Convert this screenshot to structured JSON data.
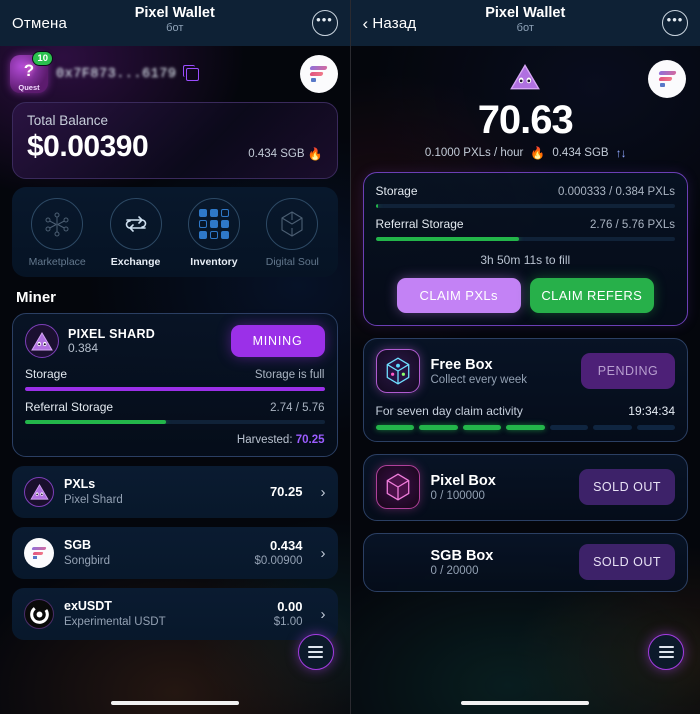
{
  "left": {
    "header": {
      "back_label": "Отмена",
      "title": "Pixel Wallet",
      "subtitle": "бот",
      "more_icon": "•••"
    },
    "quest": {
      "label": "Quest",
      "badge": "10",
      "glyph": "?"
    },
    "account": {
      "address": "0x7F873...6179",
      "copy_icon": "copy-icon"
    },
    "balance": {
      "label": "Total Balance",
      "amount": "$0.00390",
      "secondary": "0.434 SGB",
      "flame_icon": "flame-icon"
    },
    "actions": [
      {
        "name": "Marketplace",
        "icon": "nft-network-icon",
        "active": false
      },
      {
        "name": "Exchange",
        "icon": "swap-arrows-icon",
        "active": true
      },
      {
        "name": "Inventory",
        "icon": "grid-icon",
        "active": true
      },
      {
        "name": "Digital Soul",
        "icon": "cube-icon",
        "active": false
      }
    ],
    "section_title": "Miner",
    "miner": {
      "name": "PIXEL SHARD",
      "amount": "0.384",
      "button": "MINING",
      "storage_label": "Storage",
      "storage_value": "Storage is full",
      "storage_pct": 100,
      "referral_label": "Referral Storage",
      "referral_value": "2.74 / 5.76",
      "referral_pct": 47,
      "harvested_label": "Harvested:",
      "harvested_value": "70.25"
    },
    "tokens": [
      {
        "symbol": "PXLs",
        "name": "Pixel Shard",
        "value": "70.25",
        "fiat": "",
        "icon": "pixel-shard-icon"
      },
      {
        "symbol": "SGB",
        "name": "Songbird",
        "value": "0.434",
        "fiat": "$0.00900",
        "icon": "songbird-icon"
      },
      {
        "symbol": "exUSDT",
        "name": "Experimental USDT",
        "value": "0.00",
        "fiat": "$1.00",
        "icon": "usdt-icon"
      }
    ]
  },
  "right": {
    "header": {
      "back_label": "Назад",
      "title": "Pixel Wallet",
      "subtitle": "бот",
      "more_icon": "•••"
    },
    "hero": {
      "amount": "70.63",
      "rate": "0.1000 PXLs / hour",
      "sgb": "0.434 SGB",
      "flame_icon": "flame-icon",
      "swap_icon": "up-down-arrows-icon"
    },
    "storage_panel": {
      "storage_label": "Storage",
      "storage_value": "0.000333 / 0.384 PXLs",
      "storage_pct": 1,
      "referral_label": "Referral Storage",
      "referral_value": "2.76 / 5.76 PXLs",
      "referral_pct": 48,
      "fill_note": "3h 50m 11s to fill",
      "claim_pxls": "CLAIM PXLs",
      "claim_refers": "CLAIM REFERS"
    },
    "boxes": [
      {
        "title": "Free Box",
        "subtitle": "Collect every week",
        "button": "PENDING",
        "button_style": "pending",
        "icon": "free-box-icon",
        "activity_label": "For seven day claim activity",
        "activity_time": "19:34:34",
        "days_total": 7,
        "days_filled": 4
      },
      {
        "title": "Pixel Box",
        "subtitle": "0 / 100000",
        "button": "SOLD OUT",
        "button_style": "soldout",
        "icon": "pixel-box-icon"
      },
      {
        "title": "SGB Box",
        "subtitle": "0 / 20000",
        "button": "SOLD OUT",
        "button_style": "soldout",
        "icon": "sgb-box-icon"
      }
    ]
  },
  "menu_fab_icon": "hamburger-menu-icon"
}
